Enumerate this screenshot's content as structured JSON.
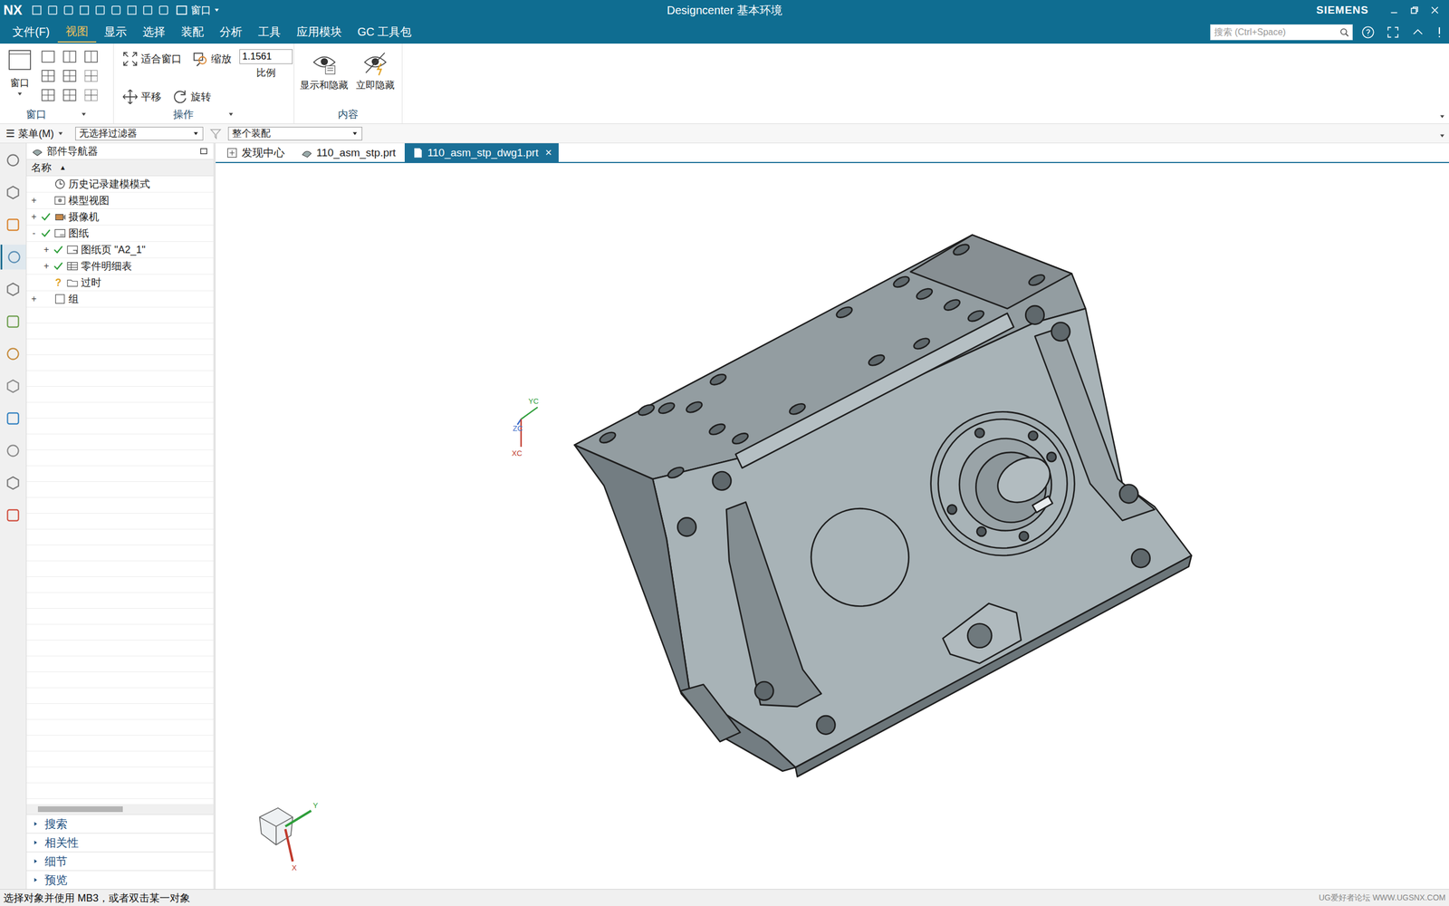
{
  "title_bar": {
    "logo": "NX",
    "window_menu": "窗口",
    "title": "Designcenter 基本环境",
    "brand": "SIEMENS"
  },
  "menu_bar": {
    "items": [
      {
        "label": "文件(F)",
        "selected": false
      },
      {
        "label": "视图",
        "selected": true
      },
      {
        "label": "显示",
        "selected": false
      },
      {
        "label": "选择",
        "selected": false
      },
      {
        "label": "装配",
        "selected": false
      },
      {
        "label": "分析",
        "selected": false
      },
      {
        "label": "工具",
        "selected": false
      },
      {
        "label": "应用模块",
        "selected": false
      },
      {
        "label": "GC 工具包",
        "selected": false
      }
    ],
    "search": {
      "placeholder": "搜索 (Ctrl+Space)"
    }
  },
  "ribbon": {
    "window_group": {
      "label": "窗口",
      "button": "窗口"
    },
    "operations": {
      "label": "操作",
      "fit": "适合窗口",
      "zoom": "缩放",
      "scale_value": "1.1561",
      "scale_label": "比例",
      "pan": "平移",
      "rotate": "旋转"
    },
    "content": {
      "label": "内容",
      "buttons": [
        "显示和隐藏",
        "立即隐藏"
      ]
    }
  },
  "toolbar": {
    "menu_icon": "☰",
    "menu": "菜单(M)",
    "filter": "无选择过滤器",
    "scope": "整个装配"
  },
  "navigator": {
    "title": "部件导航器",
    "column": "名称",
    "sort": "▲",
    "rows": [
      {
        "label": "历史记录建模模式",
        "depth": 0,
        "expander": "",
        "expanded": false,
        "checked": false,
        "mark": "",
        "kind": "history"
      },
      {
        "label": "模型视图",
        "depth": 0,
        "expander": "+",
        "expanded": false,
        "checked": false,
        "mark": "",
        "kind": "views"
      },
      {
        "label": "摄像机",
        "depth": 0,
        "expander": "+",
        "expanded": false,
        "checked": true,
        "mark": "",
        "kind": "camera"
      },
      {
        "label": "图纸",
        "depth": 0,
        "expander": "-",
        "expanded": true,
        "checked": true,
        "mark": "",
        "kind": "drawing"
      },
      {
        "label": "图纸页 \"A2_1\"",
        "depth": 1,
        "expander": "+",
        "expanded": false,
        "checked": true,
        "mark": "",
        "kind": "sheet"
      },
      {
        "label": "零件明细表",
        "depth": 1,
        "expander": "+",
        "expanded": false,
        "checked": true,
        "mark": "",
        "kind": "parts-list"
      },
      {
        "label": "过时",
        "depth": 1,
        "expander": "",
        "expanded": false,
        "checked": false,
        "mark": "?",
        "kind": "folder"
      },
      {
        "label": "组",
        "depth": 0,
        "expander": "+",
        "expanded": false,
        "checked": false,
        "mark": "",
        "kind": "group"
      }
    ],
    "sections": [
      {
        "label": "搜索",
        "expanded": false
      },
      {
        "label": "相关性",
        "expanded": false
      },
      {
        "label": "细节",
        "expanded": false
      },
      {
        "label": "预览",
        "expanded": false
      }
    ]
  },
  "doc_tabs": [
    {
      "label": "发现中心",
      "selected": false,
      "kind": "home",
      "close": ""
    },
    {
      "label": "110_asm_stp.prt",
      "selected": false,
      "kind": "part",
      "close": ""
    },
    {
      "label": "110_asm_stp_dwg1.prt",
      "selected": true,
      "kind": "drawing",
      "close": "×"
    }
  ],
  "graphics": {
    "wcs": {
      "y": "YC",
      "z": "ZC",
      "x": "XC"
    },
    "triad": {
      "y": "Y",
      "x": "X"
    }
  },
  "status_bar": {
    "prompt": "选择对象并使用 MB3，或者双击某一对象",
    "watermark": "UG爱好者论坛 WWW.UGSNX.COM"
  }
}
